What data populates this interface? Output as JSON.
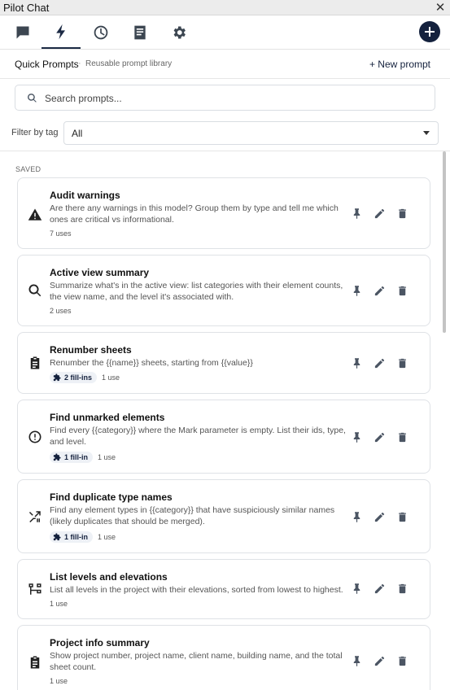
{
  "window": {
    "title": "Pilot Chat",
    "close_glyph": "✕"
  },
  "tabs": [
    {
      "name": "chat",
      "icon": "chat-icon"
    },
    {
      "name": "quick-prompts",
      "icon": "bolt-icon",
      "active": true
    },
    {
      "name": "history",
      "icon": "clock-icon"
    },
    {
      "name": "notes",
      "icon": "document-icon"
    },
    {
      "name": "settings",
      "icon": "gear-icon"
    }
  ],
  "header": {
    "title": "Quick Prompts",
    "separator": "·",
    "subtitle": "Reusable prompt library",
    "new_prompt_label": "+ New prompt"
  },
  "search": {
    "placeholder": "Search prompts...",
    "value": ""
  },
  "filter": {
    "label": "Filter by tag",
    "selected": "All"
  },
  "section": {
    "label": "SAVED"
  },
  "colors": {
    "accent": "#14213d",
    "chip_bg": "#eef1f6",
    "border": "#dfe2e6"
  },
  "prompts": [
    {
      "title": "Audit warnings",
      "icon": "warning-icon",
      "description": "Are there any warnings in this model? Group them by type and tell me which ones are critical vs informational.",
      "fill_ins": "",
      "uses": "7 uses"
    },
    {
      "title": "Active view summary",
      "icon": "search-icon",
      "description": "Summarize what's in the active view: list categories with their element counts, the view name, and the level it's associated with.",
      "fill_ins": "",
      "uses": "2 uses"
    },
    {
      "title": "Renumber sheets",
      "icon": "clipboard-icon",
      "description": "Renumber the {{name}} sheets, starting from {{value}}",
      "fill_ins": "2 fill-ins",
      "uses": "1 use"
    },
    {
      "title": "Find unmarked elements",
      "icon": "alert-circle-icon",
      "description": "Find every {{category}} where the Mark parameter is empty. List their ids, type, and level.",
      "fill_ins": "1 fill-in",
      "uses": "1 use"
    },
    {
      "title": "Find duplicate type names",
      "icon": "merge-icon",
      "description": "Find any element types in {{category}} that have suspiciously similar names (likely duplicates that should be merged).",
      "fill_ins": "1 fill-in",
      "uses": "1 use"
    },
    {
      "title": "List levels and elevations",
      "icon": "hierarchy-icon",
      "description": "List all levels in the project with their elevations, sorted from lowest to highest.",
      "fill_ins": "",
      "uses": "1 use"
    },
    {
      "title": "Project info summary",
      "icon": "clipboard-icon",
      "description": "Show project number, project name, client name, building name, and the total sheet count.",
      "fill_ins": "",
      "uses": "1 use"
    }
  ]
}
